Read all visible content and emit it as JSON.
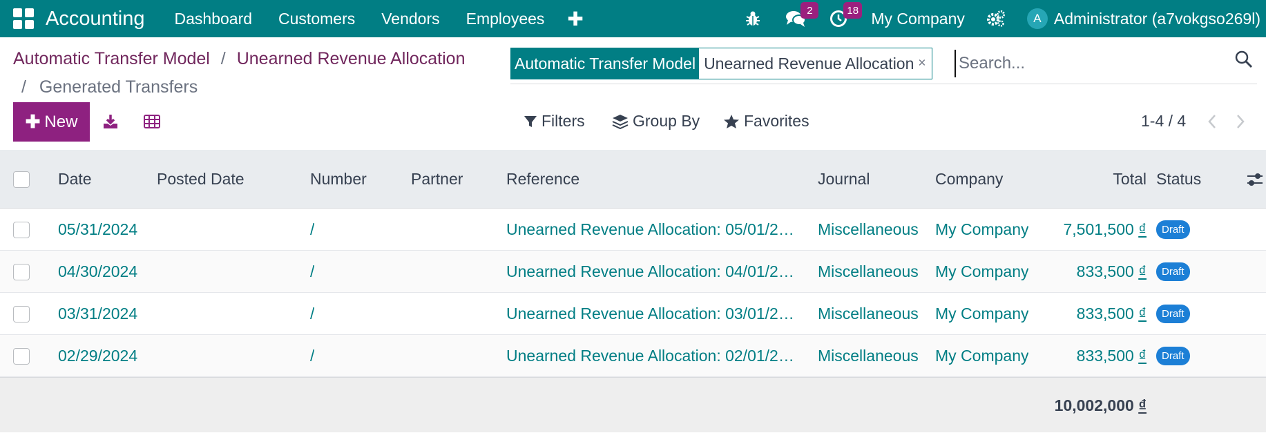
{
  "navbar": {
    "brand": "Accounting",
    "menus": [
      "Dashboard",
      "Customers",
      "Vendors",
      "Employees"
    ],
    "messages_count": "2",
    "activities_count": "18",
    "company": "My Company",
    "avatar_letter": "A",
    "user": "Administrator (a7vokgso269l)"
  },
  "breadcrumb": {
    "item1": "Automatic Transfer Model",
    "sep": "/",
    "item2": "Unearned Revenue Allocation",
    "current": "Generated Transfers"
  },
  "toolbar": {
    "new_label": "New"
  },
  "search": {
    "facet_label": "Automatic Transfer Model",
    "facet_value": "Unearned Revenue Allocation",
    "facet_remove": "×",
    "placeholder": "Search..."
  },
  "filters": {
    "filters": "Filters",
    "group_by": "Group By",
    "favorites": "Favorites"
  },
  "pager": {
    "text": "1-4 / 4"
  },
  "table": {
    "columns": {
      "date": "Date",
      "posted_date": "Posted Date",
      "number": "Number",
      "partner": "Partner",
      "reference": "Reference",
      "journal": "Journal",
      "company": "Company",
      "total": "Total",
      "status": "Status"
    },
    "rows": [
      {
        "date": "05/31/2024",
        "posted_date": "",
        "number": "/",
        "partner": "",
        "reference": "Unearned Revenue Allocation: 05/01/2…",
        "journal": "Miscellaneous",
        "company": "My Company",
        "total_amount": "7,501,500",
        "currency": "₫",
        "status": "Draft"
      },
      {
        "date": "04/30/2024",
        "posted_date": "",
        "number": "/",
        "partner": "",
        "reference": "Unearned Revenue Allocation: 04/01/2…",
        "journal": "Miscellaneous",
        "company": "My Company",
        "total_amount": "833,500",
        "currency": "₫",
        "status": "Draft"
      },
      {
        "date": "03/31/2024",
        "posted_date": "",
        "number": "/",
        "partner": "",
        "reference": "Unearned Revenue Allocation: 03/01/2…",
        "journal": "Miscellaneous",
        "company": "My Company",
        "total_amount": "833,500",
        "currency": "₫",
        "status": "Draft"
      },
      {
        "date": "02/29/2024",
        "posted_date": "",
        "number": "/",
        "partner": "",
        "reference": "Unearned Revenue Allocation: 02/01/2…",
        "journal": "Miscellaneous",
        "company": "My Company",
        "total_amount": "833,500",
        "currency": "₫",
        "status": "Draft"
      }
    ],
    "footer": {
      "total_amount": "10,002,000",
      "currency": "₫"
    }
  },
  "colors": {
    "navbar": "#017e84",
    "primary": "#8e2180",
    "link": "#017e84",
    "breadcrumb": "#71275d",
    "badge": "#9b1f7e",
    "status": "#1c7fd6"
  }
}
